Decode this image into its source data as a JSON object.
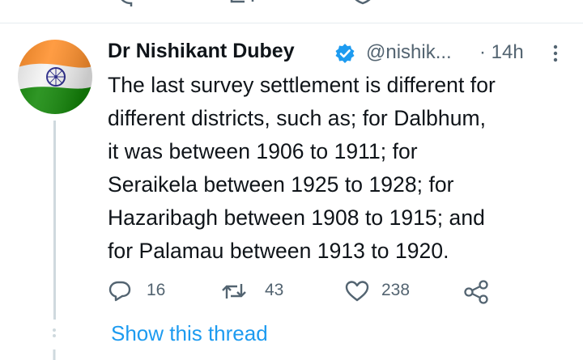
{
  "tweet": {
    "author_name": "Dr Nishikant Dubey",
    "handle": "@nishik...",
    "time": "· 14h",
    "body_lines": [
      "The last survey settlement is different for",
      "different districts, such as; for Dalbhum,",
      "it was between 1906 to 1911; for",
      "Seraikela between 1925 to 1928; for",
      "Hazaribagh between 1908 to 1915; and",
      "for Palamau between 1913 to 1920."
    ],
    "replies": "16",
    "retweets": "43",
    "likes": "238"
  },
  "show_thread_label": "Show this thread",
  "colors": {
    "accent": "#1d9bf0",
    "secondary_text": "#536471",
    "saffron": "#ff9933",
    "green": "#138808",
    "chakra": "#000080"
  },
  "icons": [
    "reply-icon",
    "retweet-icon",
    "like-icon",
    "share-icon",
    "verified-icon",
    "more-icon"
  ]
}
